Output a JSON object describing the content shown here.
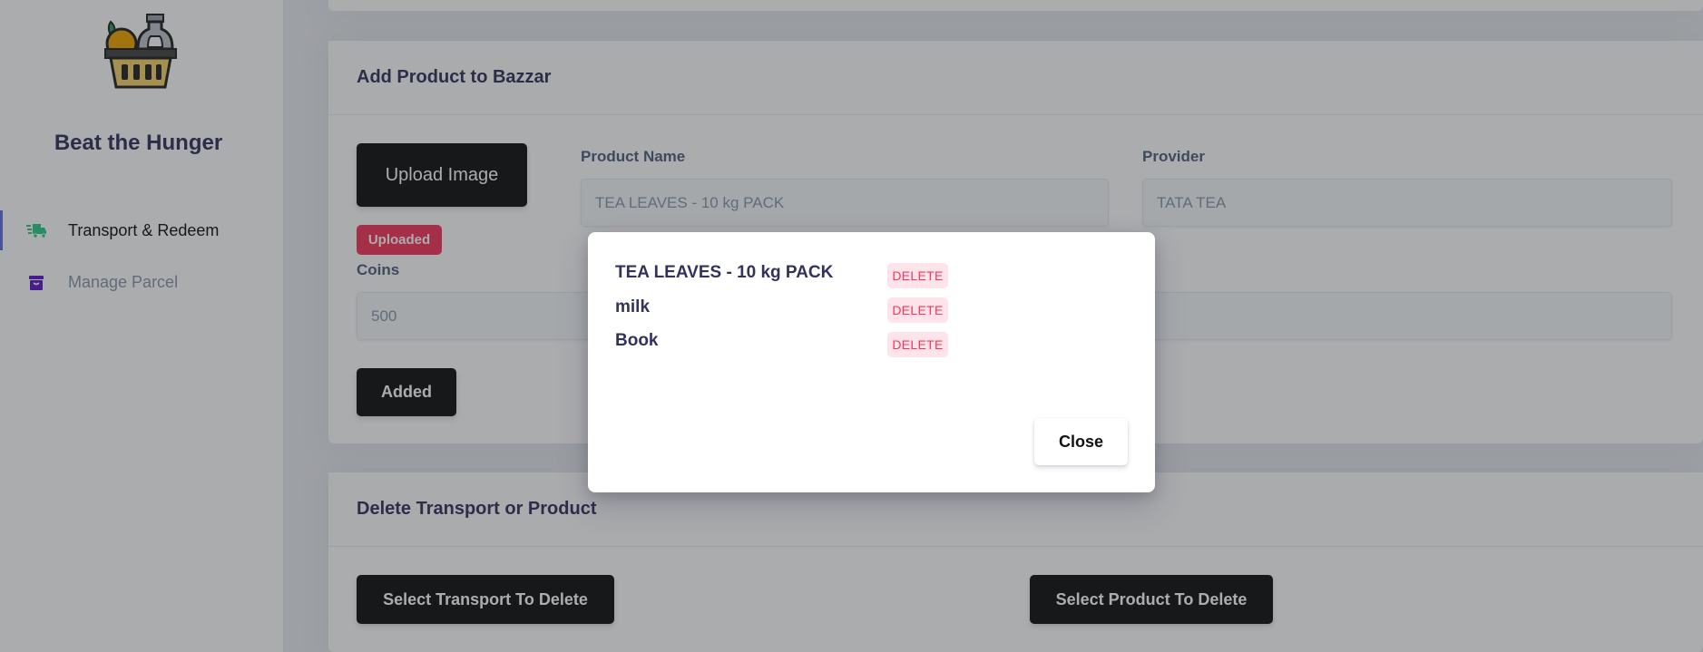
{
  "sidebar": {
    "brand": "Beat the Hunger",
    "items": [
      {
        "label": "Transport & Redeem",
        "icon": "truck-icon",
        "active": true
      },
      {
        "label": "Manage Parcel",
        "icon": "parcel-icon",
        "active": false
      }
    ]
  },
  "add_product": {
    "title": "Add Product to Bazzar",
    "upload_label": "Upload Image",
    "uploaded_badge": "Uploaded",
    "product_name_label": "Product Name",
    "product_name_value": "TEA LEAVES - 10 kg PACK",
    "provider_label": "Provider",
    "provider_value": "TATA TEA",
    "coins_label": "Coins",
    "coins_value": "500",
    "added_label": "Added"
  },
  "delete_section": {
    "title": "Delete Transport or Product",
    "select_transport_label": "Select Transport To Delete",
    "select_product_label": "Select Product To Delete"
  },
  "modal": {
    "items": [
      {
        "name": "TEA LEAVES - 10 kg PACK",
        "action": "DELETE"
      },
      {
        "name": "milk",
        "action": "DELETE"
      },
      {
        "name": "Book",
        "action": "DELETE"
      }
    ],
    "close_label": "Close"
  },
  "colors": {
    "accent": "#5e72e4",
    "danger": "#f5365c",
    "dark_button": "#111111",
    "heading": "#32325d"
  }
}
